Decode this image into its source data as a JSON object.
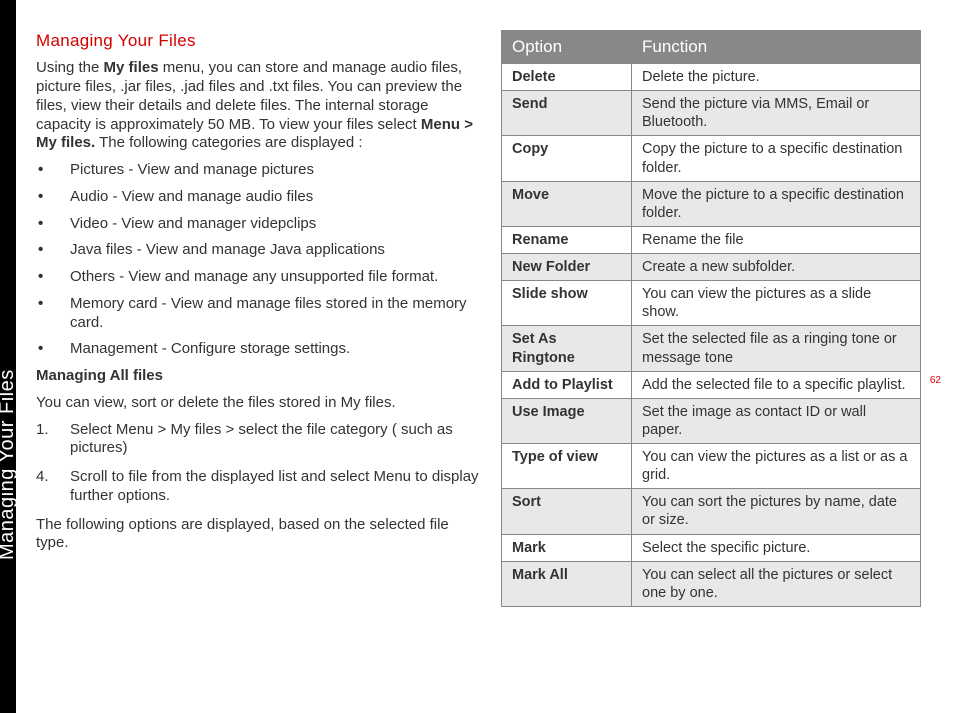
{
  "sidebar": {
    "label": "Managing Your Files"
  },
  "page_number": "62",
  "left": {
    "title": "Managing Your Files",
    "intro_segments": [
      {
        "t": "Using the "
      },
      {
        "t": "My files",
        "b": true
      },
      {
        "t": " menu, you can store and manage audio files, picture files, .jar files, .jad files and .txt files. You can preview the files, view their details and delete files. The internal storage capacity is approximately 50 MB. To view your files select "
      },
      {
        "t": "Menu > My files.",
        "b": true
      },
      {
        "t": " The following categories are displayed :"
      }
    ],
    "bullets": [
      "Pictures - View and manage pictures",
      "Audio - View and manage audio files",
      "Video - View and manager videpclips",
      "Java files - View and manage Java applications",
      "Others -  View and manage any unsupported file format.",
      "Memory card - View and manage files stored in the memory card.",
      "Management - Configure storage settings."
    ],
    "subhead": "Managing All files",
    "subpara": "You can view, sort or delete the files stored in My files.",
    "steps": [
      {
        "n": "1.",
        "segs": [
          {
            "t": "Select "
          },
          {
            "t": "Menu > My files",
            "b": true
          },
          {
            "t": " > select the file category ( such as pictures)"
          }
        ]
      },
      {
        "n": "4.",
        "segs": [
          {
            "t": "Scroll to file from the displayed list and select "
          },
          {
            "t": "Menu",
            "b": true
          },
          {
            "t": " to display further options."
          }
        ]
      }
    ],
    "trailing": "The following options are displayed, based on the selected file type."
  },
  "table": {
    "header": {
      "option": "Option",
      "function": "Function"
    },
    "rows": [
      {
        "o": "Delete",
        "f": "Delete the picture."
      },
      {
        "o": "Send",
        "f": "Send the picture via MMS, Email or Bluetooth."
      },
      {
        "o": "Copy",
        "f": "Copy the picture to a specific destination folder."
      },
      {
        "o": "Move",
        "f": "Move the picture to a specific destination folder."
      },
      {
        "o": "Rename",
        "f": "Rename the file"
      },
      {
        "o": "New Folder",
        "f": "Create a new subfolder."
      },
      {
        "o": "Slide show",
        "f": "You can view the pictures as a slide show."
      },
      {
        "o": "Set As Ringtone",
        "f": "Set the selected file as a ringing tone or message tone"
      },
      {
        "o": "Add to Playlist",
        "f": "Add the selected file to a specific playlist."
      },
      {
        "o": "Use Image",
        "f": "Set the image as contact ID or wall paper."
      },
      {
        "o": "Type of view",
        "f": "You can view the pictures as a list or as a grid."
      },
      {
        "o": "Sort",
        "f": "You can sort the pictures by name, date or size."
      },
      {
        "o": "Mark",
        "f": "Select the specific picture."
      },
      {
        "o": "Mark All",
        "f": "You can select all the pictures or select one by one."
      }
    ]
  }
}
